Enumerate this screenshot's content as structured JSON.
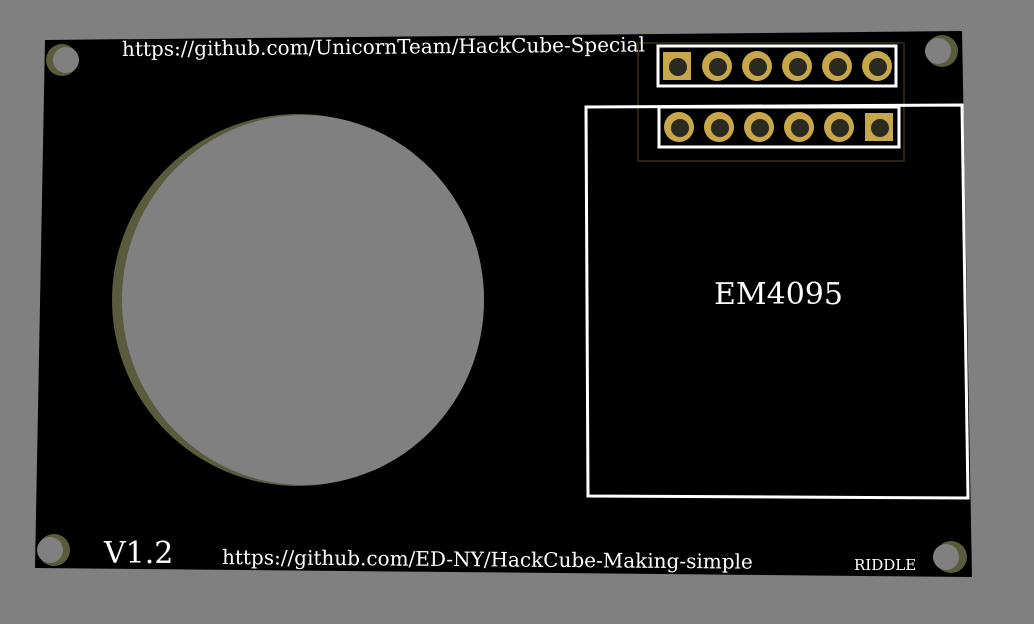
{
  "board": {
    "url_top": "https://github.com/UnicornTeam/HackCube-Special",
    "url_bottom": "https://github.com/ED-NY/HackCube-Making-simple",
    "version": "V1.2",
    "designer": "RIDDLE",
    "module_label": "EM4095"
  },
  "colors": {
    "background": "#808080",
    "board": "#000000",
    "silkscreen": "#ffffff",
    "copper": "#c8a64a",
    "cutout_edge": "#5a5a3c"
  },
  "headers": {
    "top_row_pins": 6,
    "bottom_row_pins": 6
  }
}
